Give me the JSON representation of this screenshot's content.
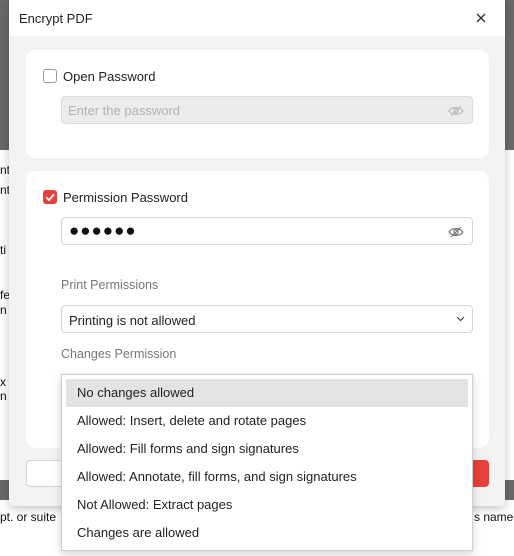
{
  "dialog": {
    "title": "Encrypt PDF"
  },
  "open_password": {
    "label": "Open Password",
    "checked": false,
    "placeholder": "Enter the password"
  },
  "permission_password": {
    "label": "Permission Password",
    "checked": true,
    "masked_value": "●●●●●●"
  },
  "print_permissions": {
    "label": "Print Permissions",
    "selected": "Printing is not allowed"
  },
  "changes_permission": {
    "label": "Changes Permission",
    "options": [
      "No changes allowed",
      "Allowed: Insert, delete and rotate pages",
      "Allowed: Fill forms and sign signatures",
      "Allowed: Annotate, fill forms, and sign signatures",
      "Not Allowed: Extract pages",
      "Changes are allowed"
    ],
    "highlighted": "No changes allowed"
  },
  "background": {
    "left_fragments": [
      "nt",
      "nt",
      "ti",
      "fe",
      "n",
      "x",
      "n",
      "pt. or suite"
    ],
    "right_fragments": [
      "s name"
    ]
  },
  "colors": {
    "accent": "#e8403a",
    "dialog_bg": "#f3f3f3"
  }
}
